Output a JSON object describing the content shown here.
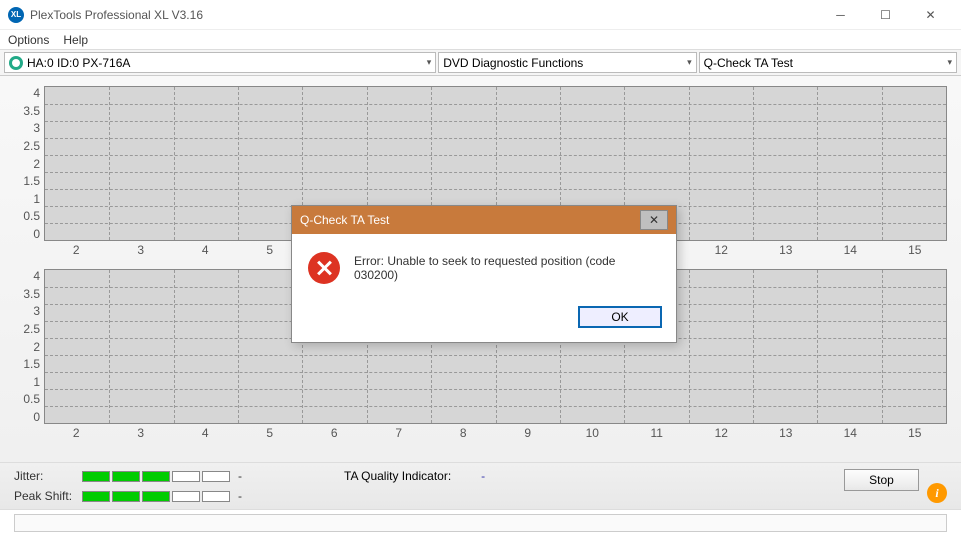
{
  "window": {
    "title": "PlexTools Professional XL V3.16",
    "app_icon_text": "XL"
  },
  "menu": {
    "options": "Options",
    "help": "Help"
  },
  "toolbar": {
    "device": "HA:0 ID:0  PX-716A",
    "category": "DVD Diagnostic Functions",
    "test": "Q-Check TA Test"
  },
  "chart_data": [
    {
      "type": "line",
      "x": [
        2,
        3,
        4,
        5,
        6,
        7,
        8,
        9,
        10,
        11,
        12,
        13,
        14,
        15
      ],
      "ylim": [
        0,
        4.5
      ],
      "yticks": [
        0,
        0.5,
        1,
        1.5,
        2,
        2.5,
        3,
        3.5,
        4
      ],
      "series": []
    },
    {
      "type": "line",
      "x": [
        2,
        3,
        4,
        5,
        6,
        7,
        8,
        9,
        10,
        11,
        12,
        13,
        14,
        15
      ],
      "ylim": [
        0,
        4.5
      ],
      "yticks": [
        0,
        0.5,
        1,
        1.5,
        2,
        2.5,
        3,
        3.5,
        4
      ],
      "series": []
    }
  ],
  "yticks_text": [
    "4",
    "3.5",
    "3",
    "2.5",
    "2",
    "1.5",
    "1",
    "0.5",
    "0"
  ],
  "xticks_text": [
    "2",
    "3",
    "4",
    "5",
    "6",
    "7",
    "8",
    "9",
    "10",
    "11",
    "12",
    "13",
    "14",
    "15"
  ],
  "status": {
    "jitter_label": "Jitter:",
    "peak_shift_label": "Peak Shift:",
    "jitter_segments": [
      true,
      true,
      true,
      false,
      false
    ],
    "peak_shift_segments": [
      true,
      true,
      true,
      false,
      false
    ],
    "jitter_value": "-",
    "peak_shift_value": "-",
    "ta_label": "TA Quality Indicator:",
    "ta_value": "-",
    "stop_label": "Stop",
    "info_icon_text": "i"
  },
  "dialog": {
    "title": "Q-Check TA Test",
    "message": "Error: Unable to seek to requested position (code 030200)",
    "ok_label": "OK"
  }
}
